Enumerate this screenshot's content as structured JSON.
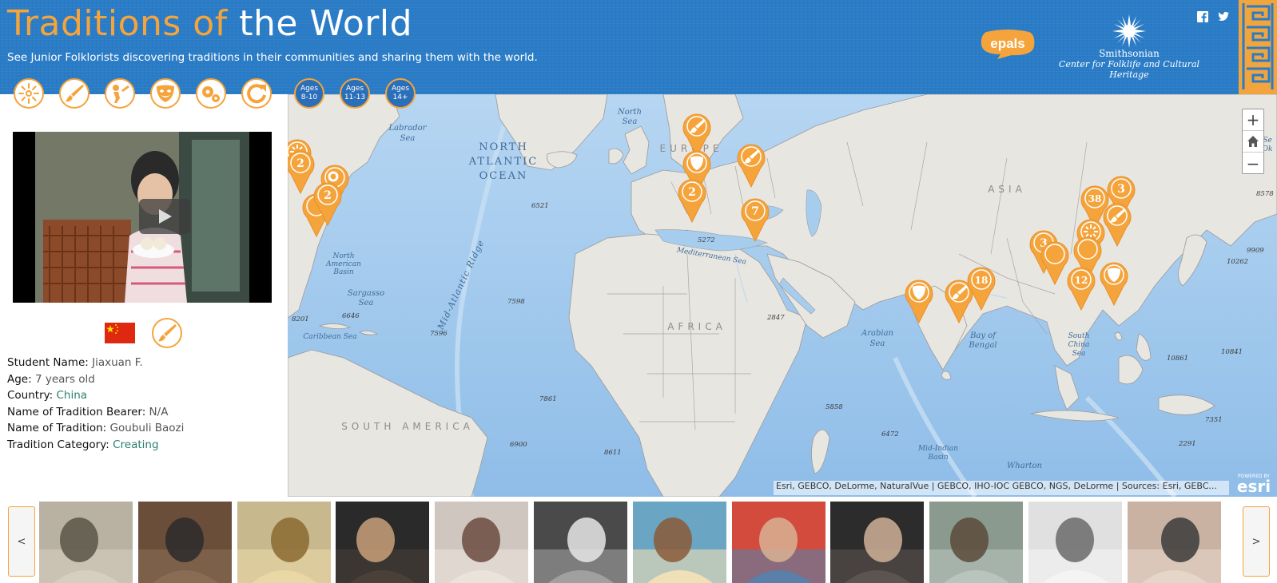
{
  "header": {
    "title_part1": "Traditions of",
    "title_part2": "the World",
    "subtitle": "See Junior Folklorists discovering traditions in their communities and sharing them with the world.",
    "epals_label": "epals",
    "smithsonian_line1": "Smithsonian",
    "smithsonian_line2": "Center for Folklife and Cultural Heritage",
    "social_icons": [
      "facebook-icon",
      "twitter-icon"
    ],
    "accent_color": "#f5a43c",
    "header_color": "#2a7cc7"
  },
  "filters": {
    "categories": [
      "celebrating-icon",
      "creating-icon",
      "playing-icon",
      "performing-icon",
      "working-icon",
      "reset-icon"
    ],
    "ages": [
      {
        "line1": "Ages",
        "line2": "8-10"
      },
      {
        "line1": "Ages",
        "line2": "11-13"
      },
      {
        "line1": "Ages",
        "line2": "14+"
      }
    ]
  },
  "student": {
    "name_label": "Student Name:",
    "name": "Jiaxuan F.",
    "age_label": "Age:",
    "age": "7 years old",
    "country_label": "Country:",
    "country": "China",
    "bearer_label": "Name of Tradition Bearer:",
    "bearer": "N/A",
    "tradition_label": "Name of Tradition:",
    "tradition": "Goubuli Baozi",
    "category_label": "Tradition Category:",
    "category": "Creating"
  },
  "map": {
    "labels": {
      "north_atlantic_1": "NORTH",
      "north_atlantic_2": "ATLANTIC",
      "north_atlantic_3": "OCEAN",
      "labrador_1": "Labrador",
      "labrador_2": "Sea",
      "north_sea_1": "North",
      "north_sea_2": "Sea",
      "europe": "EUROPE",
      "asia": "ASIA",
      "africa": "AFRICA",
      "south_america": "SOUTH AMERICA",
      "mid_atlantic": "Mid-Atlantic Ridge",
      "mediterranean": "Mediterranean Sea",
      "arabian_1": "Arabian",
      "arabian_2": "Sea",
      "bengal_1": "Bay of",
      "bengal_2": "Bengal",
      "south_china_1": "South",
      "south_china_2": "China",
      "south_china_3": "Sea",
      "na_basin_1": "North",
      "na_basin_2": "American",
      "na_basin_3": "Basin",
      "sargasso_1": "Sargasso",
      "sargasso_2": "Sea",
      "caribbean": "Caribbean Sea",
      "mid_indian_1": "Mid-Indian",
      "mid_indian_2": "Basin",
      "wharton": "Wharton",
      "sea_okh_1": "Se",
      "sea_okh_2": "Ok"
    },
    "depths": [
      "6521",
      "5272",
      "2847",
      "7598",
      "7596",
      "8201",
      "6646",
      "7861",
      "6900",
      "8611",
      "5858",
      "6472",
      "10262",
      "8578",
      "10841",
      "10861",
      "7351",
      "2291",
      "9909"
    ],
    "attribution": "Esri, GEBCO, DeLorme, NaturalVue | GEBCO, IHO-IOC GEBCO, NGS, DeLorme | Sources: Esri, GEBC...",
    "esri_line1": "POWERED BY",
    "esri_line2": "esri",
    "zoom_in": "+",
    "zoom_out": "−",
    "markers": [
      {
        "label": "",
        "icon": "celebrating-icon"
      },
      {
        "label": "2",
        "icon": ""
      },
      {
        "label": "",
        "icon": "working-icon"
      },
      {
        "label": "",
        "icon": ""
      },
      {
        "label": "2",
        "icon": ""
      },
      {
        "label": "",
        "icon": "creating-icon"
      },
      {
        "label": "",
        "icon": "performing-icon"
      },
      {
        "label": "2",
        "icon": ""
      },
      {
        "label": "",
        "icon": "creating-icon"
      },
      {
        "label": "7",
        "icon": ""
      },
      {
        "label": "",
        "icon": "performing-icon"
      },
      {
        "label": "",
        "icon": "creating-icon"
      },
      {
        "label": "18",
        "icon": ""
      },
      {
        "label": "3",
        "icon": ""
      },
      {
        "label": "",
        "icon": ""
      },
      {
        "label": "38",
        "icon": ""
      },
      {
        "label": "3",
        "icon": ""
      },
      {
        "label": "",
        "icon": "creating-icon"
      },
      {
        "label": "",
        "icon": "celebrating-icon"
      },
      {
        "label": "",
        "icon": ""
      },
      {
        "label": "12",
        "icon": ""
      },
      {
        "label": "",
        "icon": "performing-icon"
      }
    ]
  },
  "carousel": {
    "prev": "<",
    "next": ">",
    "thumbnails": [
      "student-thumb-1",
      "student-thumb-2",
      "student-thumb-3",
      "student-thumb-4",
      "student-thumb-5",
      "student-thumb-6",
      "student-thumb-7",
      "student-thumb-8",
      "student-thumb-9",
      "student-thumb-10",
      "student-thumb-11",
      "student-thumb-12"
    ]
  }
}
